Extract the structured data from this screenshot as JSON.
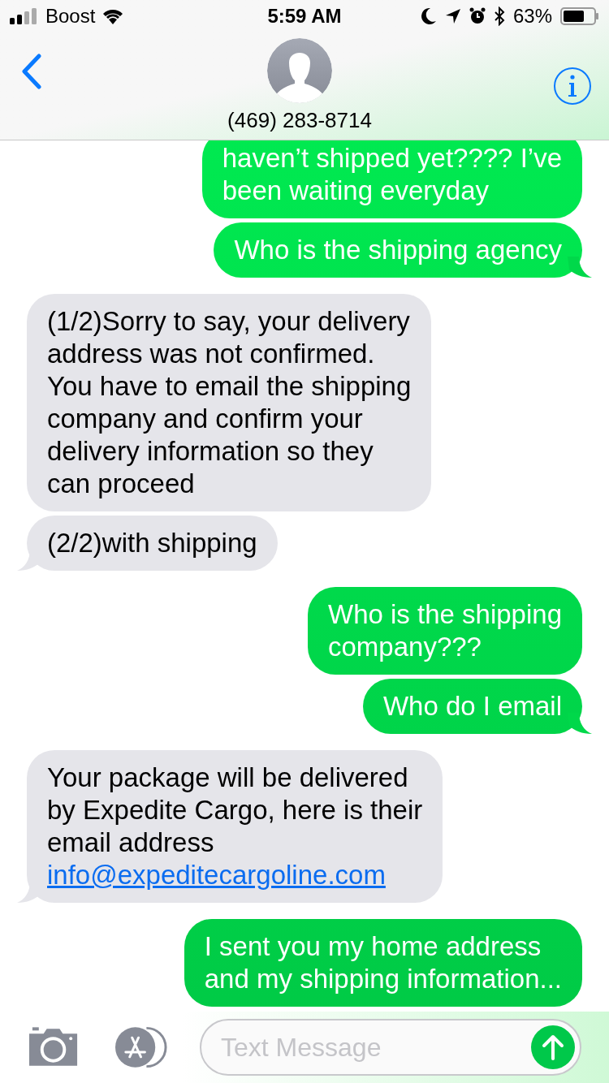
{
  "status_bar": {
    "carrier": "Boost",
    "time": "5:59 AM",
    "battery": "63%"
  },
  "header": {
    "contact": "(469) 283-8714"
  },
  "messages": [
    {
      "kind": "sent",
      "text": "haven’t shipped yet???? I’ve\nbeen waiting everyday",
      "tail": false
    },
    {
      "kind": "sent",
      "text": "Who is the shipping agency",
      "tail": true
    },
    {
      "kind": "received",
      "text": "(1/2)Sorry to say, your delivery\naddress was not confirmed.\nYou have to email the shipping\ncompany and confirm your\ndelivery information so they\ncan proceed",
      "tail": false
    },
    {
      "kind": "received",
      "text": "(2/2)with shipping",
      "tail": true
    },
    {
      "kind": "sent",
      "text": "Who is the shipping\ncompany???",
      "tail": false
    },
    {
      "kind": "sent",
      "text": "Who do I email",
      "tail": true
    },
    {
      "kind": "received",
      "text": "Your package will be delivered\nby Expedite Cargo, here is their\nemail address",
      "link": "info@expeditecargoline.com",
      "tail": true
    },
    {
      "kind": "sent",
      "text": "I sent you my home address\nand my shipping information...",
      "tail": false
    }
  ],
  "composer": {
    "placeholder": "Text Message"
  }
}
